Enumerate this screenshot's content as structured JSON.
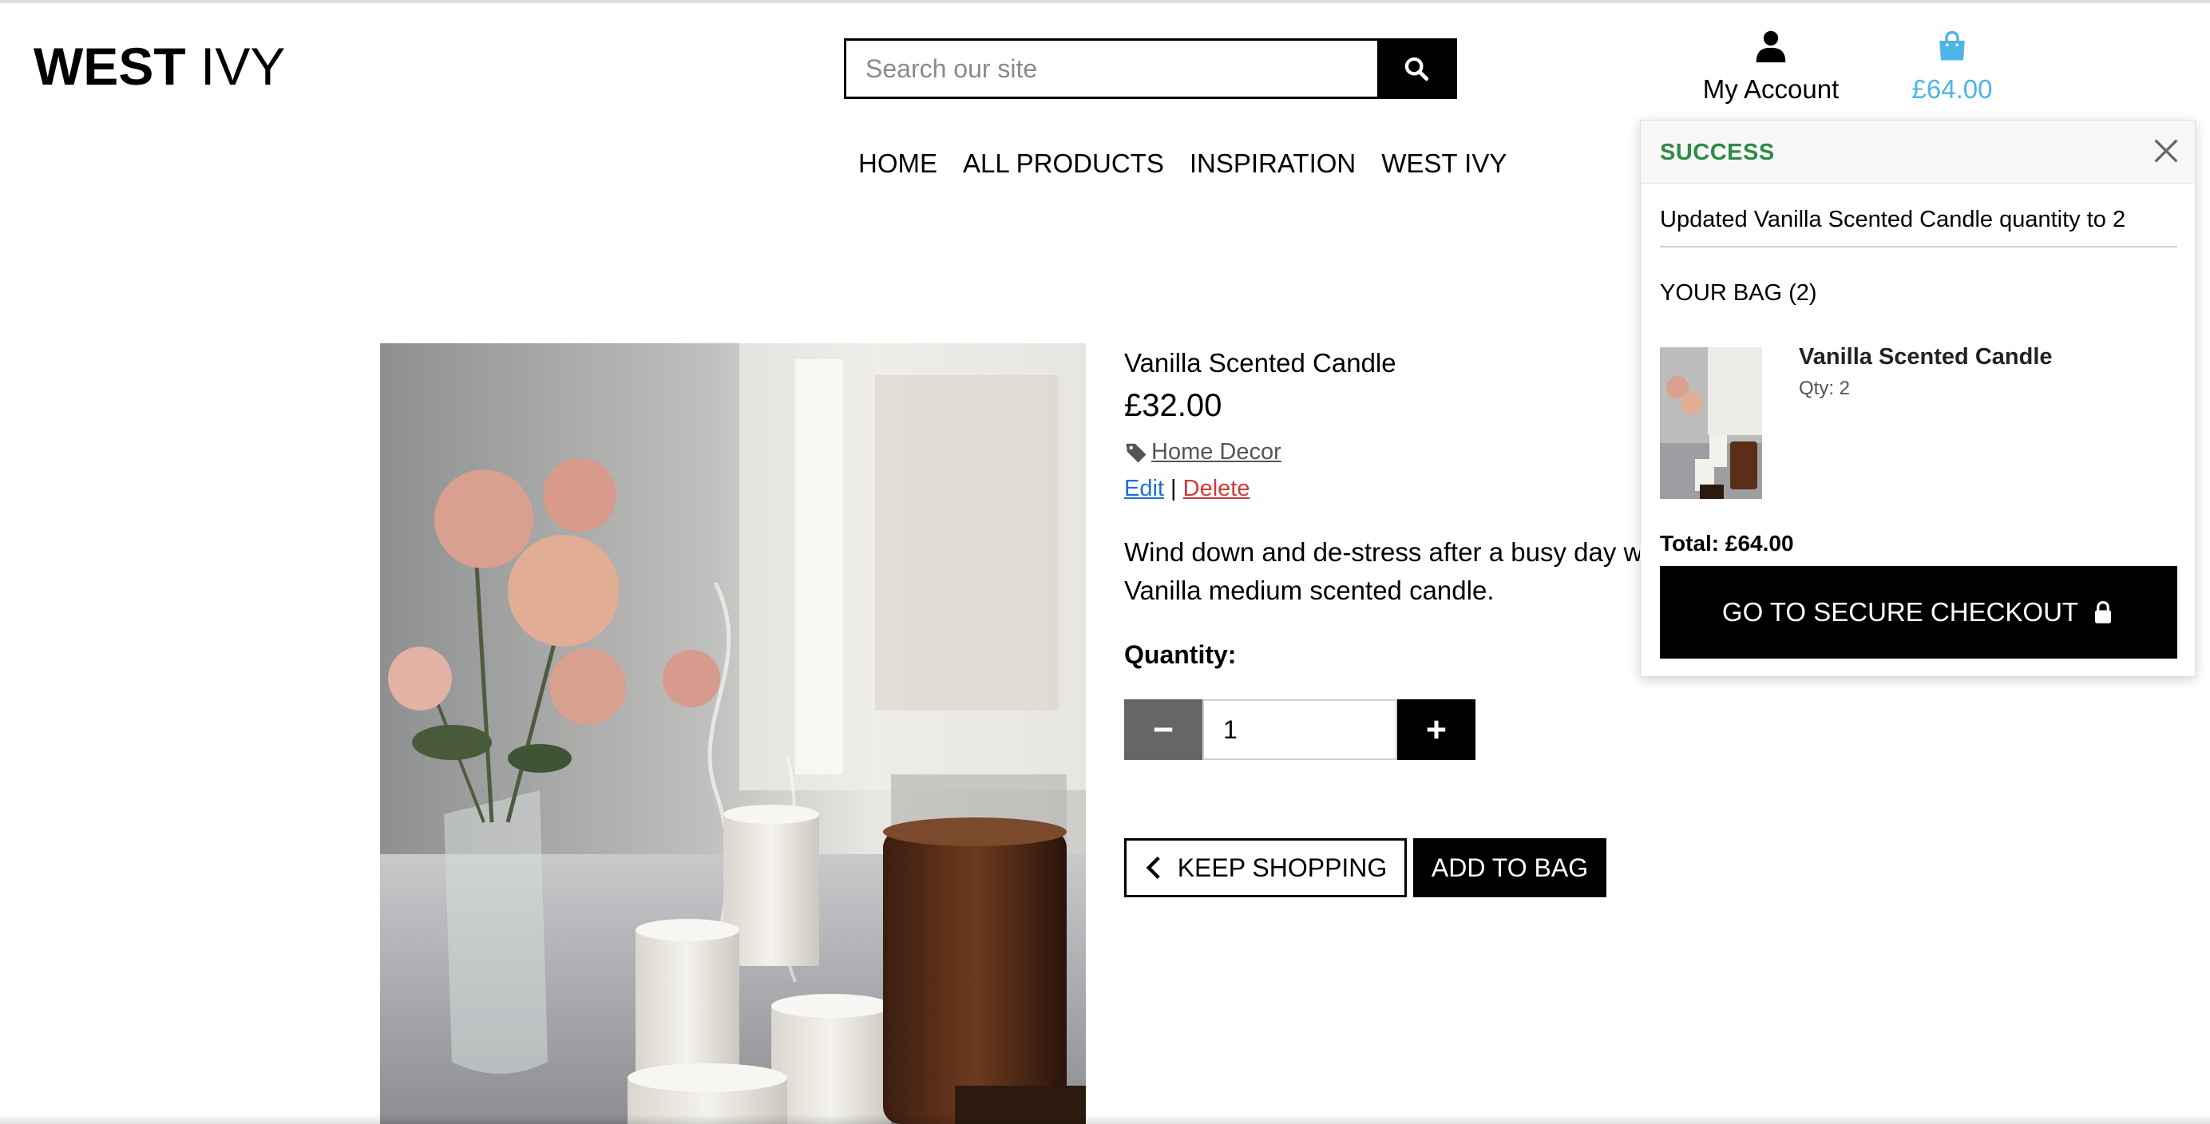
{
  "header": {
    "logo_bold": "WEST",
    "logo_regular": "IVY",
    "search_placeholder": "Search our site",
    "account_label": "My Account",
    "bag_total": "£64.00"
  },
  "nav": {
    "items": [
      "HOME",
      "ALL PRODUCTS",
      "INSPIRATION",
      "WEST IVY"
    ]
  },
  "product": {
    "name": "Vanilla Scented Candle",
    "price": "£32.00",
    "category": "Home Decor",
    "edit_label": "Edit",
    "separator": "|",
    "delete_label": "Delete",
    "description_line1": "Wind down and de-stress after a busy day w",
    "description_line2": "Vanilla medium scented candle.",
    "quantity_label": "Quantity:",
    "quantity_value": "1",
    "keep_shopping_label": "KEEP SHOPPING",
    "add_to_bag_label": "ADD TO BAG"
  },
  "toast": {
    "title": "SUCCESS",
    "message": "Updated Vanilla Scented Candle quantity to 2",
    "bag_count": "YOUR BAG (2)",
    "item_name": "Vanilla Scented Candle",
    "item_qty": "Qty: 2",
    "total": "Total: £64.00",
    "checkout_label": "GO TO SECURE CHECKOUT"
  },
  "colors": {
    "accent_bag": "#4fb5e6",
    "success": "#2f8a46",
    "edit_link": "#1f6fd8",
    "delete_link": "#d03a3a"
  },
  "icons": [
    "search-icon",
    "user-icon",
    "shopping-bag-icon",
    "tag-icon",
    "minus-icon",
    "plus-icon",
    "chevron-left-icon",
    "close-icon",
    "lock-icon"
  ]
}
